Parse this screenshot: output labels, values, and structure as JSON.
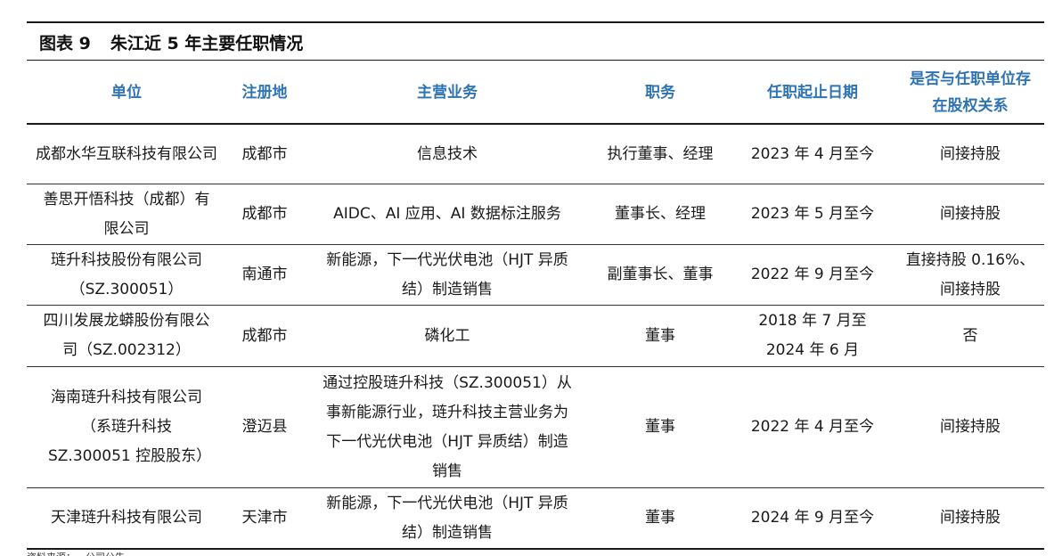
{
  "caption": {
    "label": "图表 9",
    "title": "朱江近 5 年主要任职情况"
  },
  "headers": [
    "单位",
    "注册地",
    "主营业务",
    "职务",
    "任职起止日期",
    "是否与任职单位存在股权关系"
  ],
  "rows": [
    {
      "unit": "成都水华互联科技有限公司",
      "location": "成都市",
      "business": "信息技术",
      "position": "执行董事、经理",
      "period": "2023 年 4 月至今",
      "equity": "间接持股"
    },
    {
      "unit": "善思开悟科技（成都）有限公司",
      "location": "成都市",
      "business": "AIDC、AI 应用、AI 数据标注服务",
      "position": "董事长、经理",
      "period": "2023 年 5 月至今",
      "equity": "间接持股"
    },
    {
      "unit": "琏升科技股份有限公司（SZ.300051）",
      "location": "南通市",
      "business": "新能源，下一代光伏电池（HJT 异质结）制造销售",
      "position": "副董事长、董事",
      "period": "2022 年 9 月至今",
      "equity": "直接持股 0.16%、间接持股"
    },
    {
      "unit": "四川发展龙蟒股份有限公司（SZ.002312）",
      "location": "成都市",
      "business": "磷化工",
      "position": "董事",
      "period": "2018 年 7 月至 2024 年 6 月",
      "equity": "否"
    },
    {
      "unit": "海南琏升科技有限公司（系琏升科技 SZ.300051 控股股东）",
      "location": "澄迈县",
      "business": "通过控股琏升科技（SZ.300051）从事新能源行业，琏升科技主营业务为下一代光伏电池（HJT 异质结）制造销售",
      "position": "董事",
      "period": "2022 年 4 月至今",
      "equity": "间接持股"
    },
    {
      "unit": "天津琏升科技有限公司",
      "location": "天津市",
      "business": "新能源，下一代光伏电池（HJT 异质结）制造销售",
      "position": "董事",
      "period": "2024 年 9 月至今",
      "equity": "间接持股"
    }
  ],
  "footer": "资料来源：…公司公告…"
}
